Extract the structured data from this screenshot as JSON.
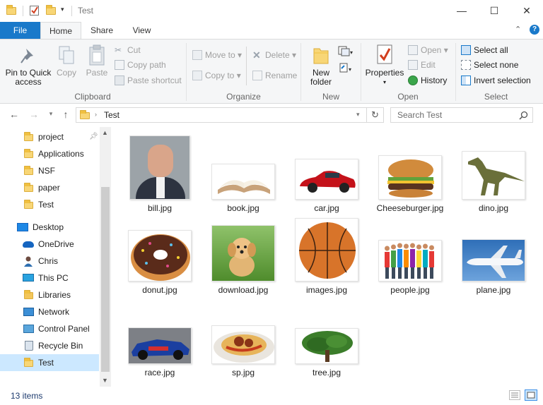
{
  "window": {
    "title": "Test",
    "controls": {
      "minimize": "—",
      "maximize": "☐",
      "close": "✕"
    }
  },
  "ribbon_tabs": {
    "file": "File",
    "home": "Home",
    "share": "Share",
    "view": "View"
  },
  "ribbon": {
    "clipboard": {
      "label": "Clipboard",
      "pin": "Pin to Quick access",
      "copy": "Copy",
      "paste": "Paste",
      "cut": "Cut",
      "copy_path": "Copy path",
      "paste_shortcut": "Paste shortcut"
    },
    "organize": {
      "label": "Organize",
      "move_to": "Move to",
      "copy_to": "Copy to",
      "delete": "Delete",
      "rename": "Rename"
    },
    "new": {
      "label": "New",
      "new_folder": "New folder"
    },
    "open": {
      "label": "Open",
      "properties": "Properties",
      "open": "Open",
      "edit": "Edit",
      "history": "History"
    },
    "select": {
      "label": "Select",
      "select_all": "Select all",
      "select_none": "Select none",
      "invert": "Invert selection"
    }
  },
  "address": {
    "path": "Test",
    "search_placeholder": "Search Test"
  },
  "nav_pane": {
    "quick_access": [
      "project",
      "Applications",
      "NSF",
      "paper",
      "Test"
    ],
    "desktop": "Desktop",
    "desktop_children": [
      "OneDrive",
      "Chris",
      "This PC",
      "Libraries",
      "Network",
      "Control Panel",
      "Recycle Bin",
      "Test"
    ]
  },
  "files": [
    "bill.jpg",
    "book.jpg",
    "car.jpg",
    "Cheeseburger.jpg",
    "dino.jpg",
    "donut.jpg",
    "download.jpg",
    "images.jpg",
    "people.jpg",
    "plane.jpg",
    "race.jpg",
    "sp.jpg",
    "tree.jpg"
  ],
  "status": {
    "count": "13 items"
  },
  "colors": {
    "accent": "#1979ca",
    "selected": "#cce8ff",
    "folder": "#f8d676"
  }
}
